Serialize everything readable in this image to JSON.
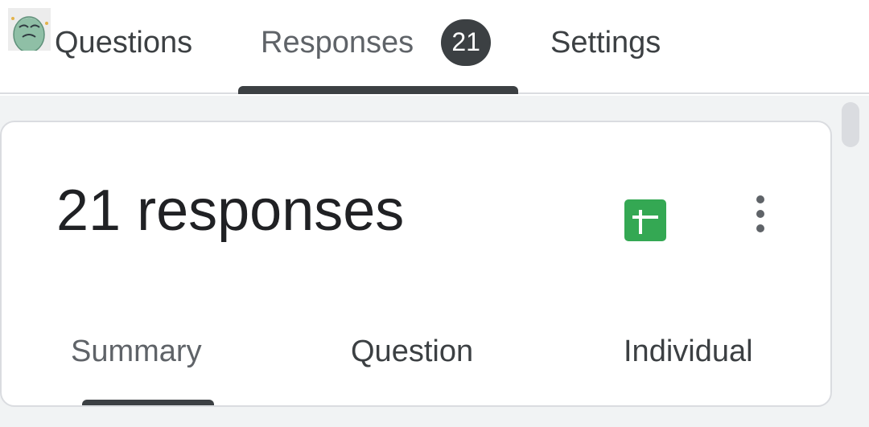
{
  "top_tabs": {
    "questions": "Questions",
    "responses": "Responses",
    "responses_count": "21",
    "settings": "Settings",
    "active": "Responses"
  },
  "summary_card": {
    "title": "21 responses",
    "sheets_icon": "google-sheets-icon",
    "menu_icon": "more-vert-icon"
  },
  "sub_tabs": {
    "summary": "Summary",
    "question": "Question",
    "individual": "Individual",
    "active": "Summary"
  },
  "colors": {
    "accent": "#3c4043",
    "sheets_green": "#34a853",
    "background": "#f1f3f4"
  }
}
